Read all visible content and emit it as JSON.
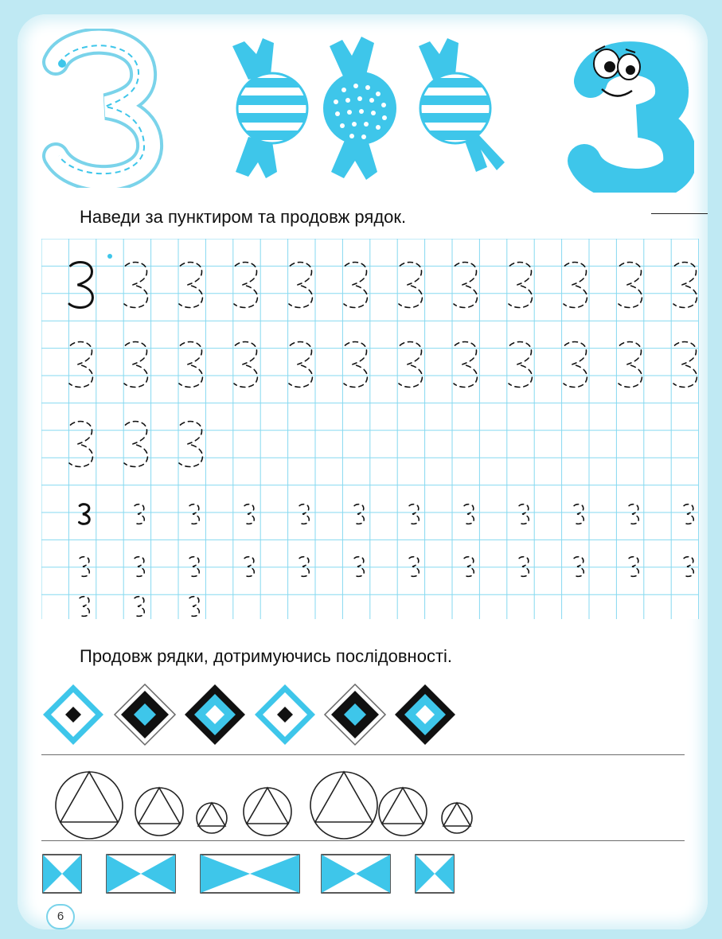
{
  "digit": "3",
  "instructions": {
    "trace": "Наведи за пунктиром та продовж рядок.",
    "continue": "Продовж рядки, дотримуючись послідовності."
  },
  "page_number": "6",
  "colors": {
    "accent": "#3ec6ea",
    "grid": "#86d9f0",
    "ink": "#111111",
    "background": "#bfe9f3"
  },
  "icons": [
    "traced-digit-three-icon",
    "candy-icon",
    "cartoon-digit-three-icon"
  ]
}
